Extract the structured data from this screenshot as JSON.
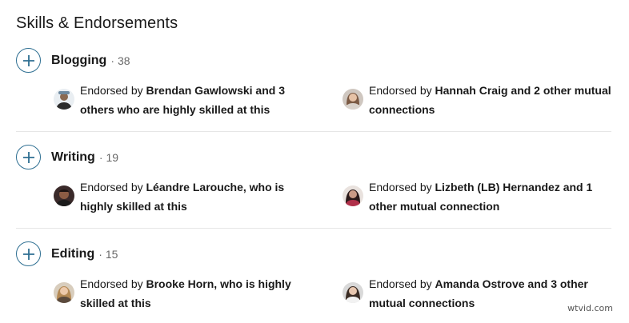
{
  "section": {
    "title": "Skills & Endorsements"
  },
  "skills": [
    {
      "name": "Blogging",
      "separator": "·",
      "count": "38",
      "endorsements": [
        {
          "prefix": "Endorsed by ",
          "bold": "Brendan Gawlowski and 3 others who are highly skilled at this",
          "avatar": "avatar-man-dark-hat"
        },
        {
          "prefix": "Endorsed by ",
          "bold": "Hannah Craig and 2 other mutual connections",
          "avatar": "avatar-woman-light-hair"
        }
      ]
    },
    {
      "name": "Writing",
      "separator": "·",
      "count": "19",
      "endorsements": [
        {
          "prefix": "Endorsed by ",
          "bold": "Léandre Larouche, who is highly skilled at this",
          "avatar": "avatar-man-dark"
        },
        {
          "prefix": "Endorsed by ",
          "bold": "Lizbeth (LB) Hernandez and 1 other mutual connection",
          "avatar": "avatar-woman-dark-hair"
        }
      ]
    },
    {
      "name": "Editing",
      "separator": "·",
      "count": "15",
      "endorsements": [
        {
          "prefix": "Endorsed by ",
          "bold": "Brooke Horn, who is highly skilled at this",
          "avatar": "avatar-woman-blonde"
        },
        {
          "prefix": "Endorsed by ",
          "bold": "Amanda Ostrove and 3 other mutual connections",
          "avatar": "avatar-woman-brown-hair"
        }
      ]
    }
  ],
  "watermark": "wtvid.com",
  "colors": {
    "accent": "#2e6f92",
    "divider": "#e6e6e6"
  }
}
